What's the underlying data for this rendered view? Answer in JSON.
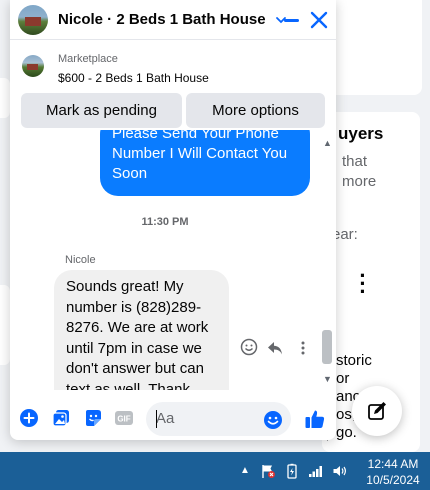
{
  "background": {
    "right_card_heading": "uyers",
    "right_card_text_lines": [
      "that",
      "more"
    ],
    "right_card_text3": "ear:",
    "right_card_text4_lines": [
      "storic",
      "or",
      "anc",
      "os,",
      "go."
    ]
  },
  "chat": {
    "header_title": "Nicole · 2 Beds 1 Bath House",
    "listing": {
      "kind": "Marketplace",
      "description": "$600 - 2 Beds 1 Bath House"
    },
    "buttons": {
      "mark_pending": "Mark as pending",
      "more_options": "More options"
    },
    "outgoing_message_lines": [
      "Please Send Your Phone",
      "Number I Will Contact You",
      "Soon"
    ],
    "timestamp": "11:30 PM",
    "sender_name": "Nicole",
    "incoming_message": "Sounds great! My number is (828)289-8276. We are at work until 7pm in case we don't answer but can text as well. Thank you",
    "composer": {
      "placeholder": "Aa",
      "gif_label": "GIF"
    }
  },
  "taskbar": {
    "time": "12:44 AM",
    "date": "10/5/2024"
  },
  "colors": {
    "messenger_blue": "#0866ff",
    "bubble_blue": "#0a7cff",
    "taskbar": "#1b5f97"
  }
}
